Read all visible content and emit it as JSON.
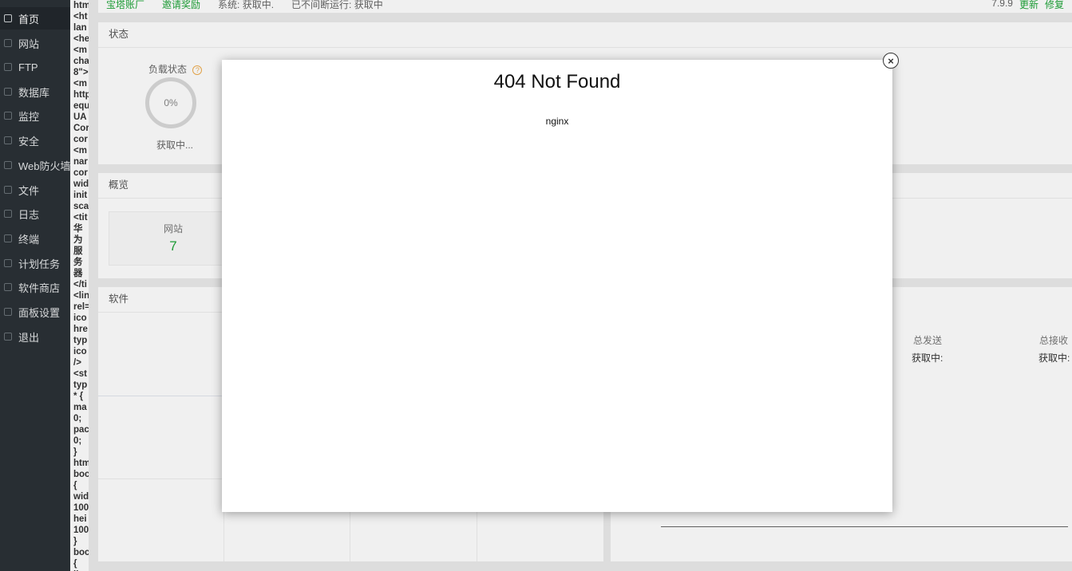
{
  "sidebar": {
    "items": [
      {
        "label": "首页",
        "icon": "home-icon"
      },
      {
        "label": "网站",
        "icon": "globe-icon"
      },
      {
        "label": "FTP",
        "icon": "ftp-icon"
      },
      {
        "label": "数据库",
        "icon": "database-icon"
      },
      {
        "label": "监控",
        "icon": "monitor-icon"
      },
      {
        "label": "安全",
        "icon": "shield-icon"
      },
      {
        "label": "Web防火墙",
        "icon": "firewall-icon"
      },
      {
        "label": "文件",
        "icon": "folder-icon"
      },
      {
        "label": "日志",
        "icon": "log-icon"
      },
      {
        "label": "终端",
        "icon": "terminal-icon"
      },
      {
        "label": "计划任务",
        "icon": "calendar-icon"
      },
      {
        "label": "软件商店",
        "icon": "grid-icon"
      },
      {
        "label": "面板设置",
        "icon": "gear-icon"
      },
      {
        "label": "退出",
        "icon": "logout-icon"
      }
    ]
  },
  "raw_html_text": "htm\n<ht\nlan\n<he\n<m\ncha\n8\">\n<m\nhttp\nequ\nUA\nCor\ncor\n<m\nnar\ncor\nwid\ninit\nsca\n<tit\n华\n为\n服\n务\n器\n</ti\n<lin\nrel=\nico\nhre\ntyp\nico\n/>\n<st\ntyp\n* {\nma\n0;\npac\n0;\n}\nhtm\nboc\n{\nwid\n100\nhei\n100\n}\nboc\n{\nlin",
  "topbar": {
    "account": "宝塔账厂",
    "invite": "邀请奖励",
    "system": "系统: 获取中.",
    "uptime": "已不间断运行: 获取中",
    "version": "7.9.9",
    "update": "更新",
    "repair": "修复"
  },
  "status_panel": {
    "title": "状态",
    "load_label": "负载状态",
    "load_value": "0%",
    "load_state": "获取中..."
  },
  "overview_panel": {
    "title": "概览",
    "site_label": "网站",
    "site_count": "7"
  },
  "software_panel": {
    "title": "软件"
  },
  "traffic": {
    "sent_label": "总发送",
    "sent_value": "获取中:",
    "recv_label": "总接收",
    "recv_value": "获取中:"
  },
  "modal": {
    "heading": "404 Not Found",
    "server": "nginx",
    "close_symbol": "×"
  },
  "colors": {
    "sidebar_bg": "#2b3137",
    "accent_green": "#20a53a",
    "help_orange": "#f0ad4e"
  }
}
